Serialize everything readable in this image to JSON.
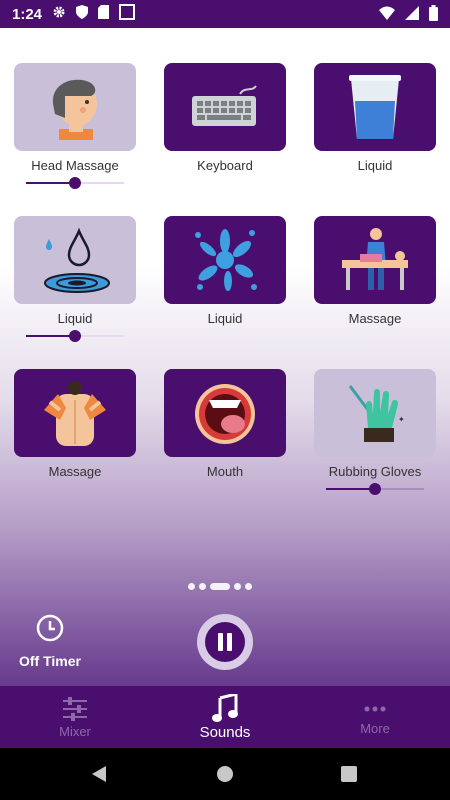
{
  "status": {
    "time": "1:24"
  },
  "tiles": [
    {
      "label": "Head Massage",
      "volume": 0.5
    },
    {
      "label": "Keyboard"
    },
    {
      "label": "Liquid"
    },
    {
      "label": "Liquid",
      "volume": 0.5
    },
    {
      "label": "Liquid"
    },
    {
      "label": "Massage"
    },
    {
      "label": "Massage"
    },
    {
      "label": "Mouth"
    },
    {
      "label": "Rubbing Gloves",
      "volume": 0.5
    }
  ],
  "pager": {
    "count": 5,
    "active": 2
  },
  "timer": {
    "label": "Off Timer"
  },
  "nav": {
    "mixer": "Mixer",
    "sounds": "Sounds",
    "more": "More"
  },
  "colors": {
    "primary": "#4a0f6e",
    "tile_selected": "#c9bfd9"
  }
}
